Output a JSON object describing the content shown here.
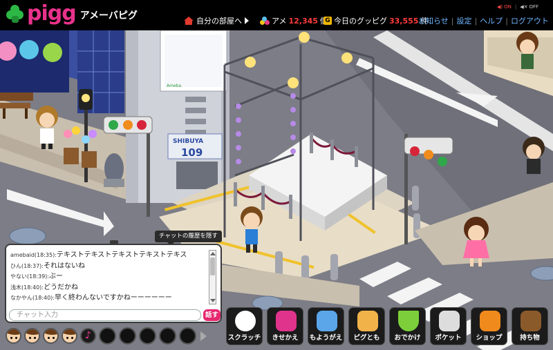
{
  "header": {
    "logo_text": "pigg",
    "logo_sub": "アメーバピグ",
    "my_room": "自分の部屋へ",
    "ame_label": "アメ",
    "ame_count": "12,345",
    "ame_unit": "個",
    "guppy_label": "今日のグッピグ",
    "guppy_count": "33,555",
    "guppy_unit": "件",
    "nav": [
      "お知らせ",
      "設定",
      "ヘルプ",
      "ログアウト"
    ],
    "sound_on": "ON",
    "sound_off": "OFF"
  },
  "scene": {
    "billboard": "SHIBUYA",
    "billboard_num": "109",
    "ameba_sign": "Ameba"
  },
  "chat": {
    "hide_tooltip": "チャットの履歴を隠す",
    "messages": [
      {
        "name": "amebaid(18:35):",
        "text": "テキストテキストテキストテキストテキス"
      },
      {
        "name": "ひん(18:37):",
        "text": "それはないね"
      },
      {
        "name": "やない(18:39):",
        "text": "ぶー"
      },
      {
        "name": "浅木(18:40):",
        "text": "どうだかね"
      },
      {
        "name": "なかやん(18:40):",
        "text": "早く終わんないですかねーーーーーー"
      }
    ],
    "input_placeholder": "チャット入力",
    "send_label": "話す"
  },
  "emotes": [
    "face",
    "face",
    "face",
    "face",
    "music",
    "empty",
    "empty",
    "empty",
    "empty",
    "empty"
  ],
  "toolbar": [
    {
      "label": "スクラッチ",
      "icon": "scratch-icon",
      "color": "#ffffff"
    },
    {
      "label": "きせかえ",
      "icon": "dressup-icon",
      "color": "#e0338c"
    },
    {
      "label": "もようがえ",
      "icon": "redecorate-icon",
      "color": "#5aa6e8"
    },
    {
      "label": "ピグとも",
      "icon": "friends-icon",
      "color": "#f2b24a"
    },
    {
      "label": "おでかけ",
      "icon": "outing-icon",
      "color": "#7ccf3a"
    },
    {
      "label": "ポケット",
      "icon": "pocket-icon",
      "color": "#dddddd"
    },
    {
      "label": "ショップ",
      "icon": "shop-icon",
      "color": "#f08a1c"
    },
    {
      "label": "持ち物",
      "icon": "items-icon",
      "color": "#8b5a2b"
    }
  ]
}
